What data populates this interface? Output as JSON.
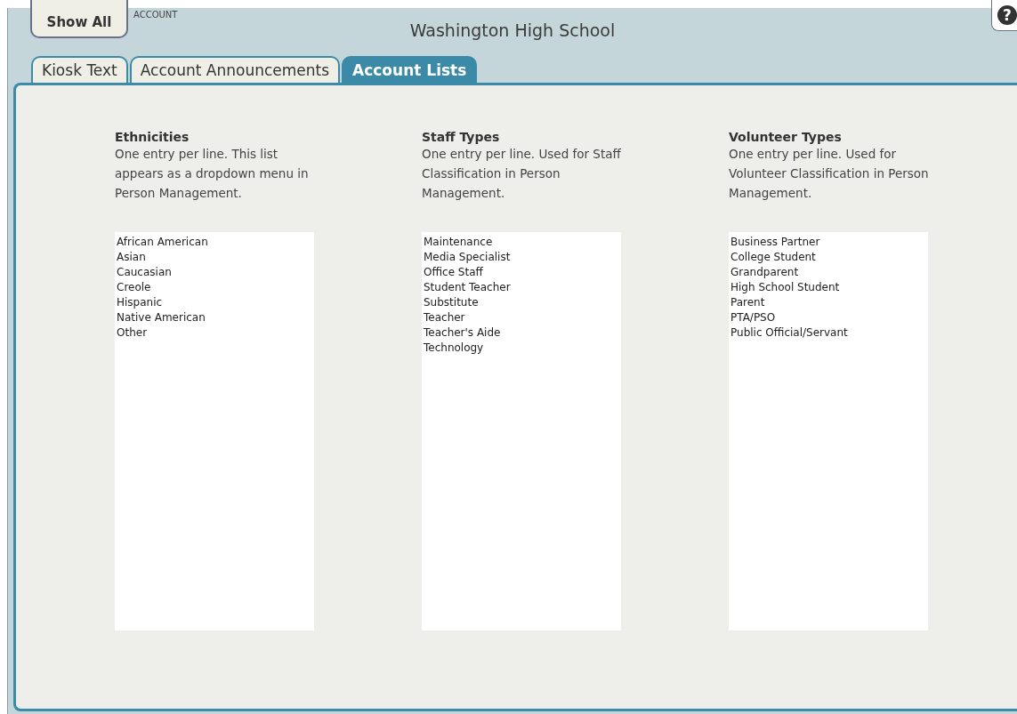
{
  "header": {
    "show_all_button": "Show All",
    "section_label": "ACCOUNT",
    "title": "Washington High School",
    "help_icon": "?"
  },
  "tabs": [
    {
      "label": "Kiosk Text",
      "selected": false
    },
    {
      "label": "Account Announcements",
      "selected": false
    },
    {
      "label": "Account Lists",
      "selected": true
    }
  ],
  "lists": [
    {
      "heading": "Ethnicities",
      "description": "One entry per line. This list appears as a dropdown menu in Person Management.",
      "entries": [
        "African American",
        "Asian",
        "Caucasian",
        "Creole",
        "Hispanic",
        "Native American",
        "Other"
      ]
    },
    {
      "heading": "Staff Types",
      "description": "One entry per line. Used for Staff Classification in Person Management.",
      "entries": [
        "Maintenance",
        "Media Specialist",
        "Office Staff",
        "Student Teacher",
        "Substitute",
        "Teacher",
        "Teacher's Aide",
        "Technology"
      ]
    },
    {
      "heading": "Volunteer Types",
      "description": "One entry per line. Used for Volunteer Classification in Person Management.",
      "entries": [
        "Business Partner",
        "College Student",
        "Grandparent",
        "High School Student",
        "Parent",
        "PTA/PSO",
        "Public Official/Servant"
      ]
    }
  ]
}
